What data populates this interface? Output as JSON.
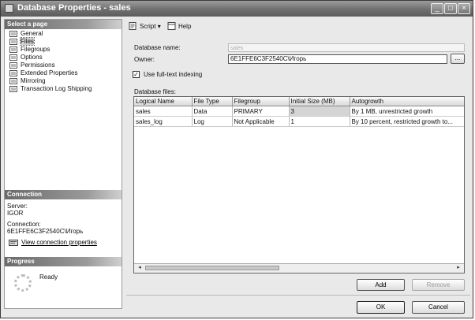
{
  "window": {
    "title": "Database Properties - sales",
    "minimize": "_",
    "maximize": "□",
    "close": "×"
  },
  "sidebar": {
    "header": "Select a page",
    "items": [
      {
        "label": "General"
      },
      {
        "label": "Files"
      },
      {
        "label": "Filegroups"
      },
      {
        "label": "Options"
      },
      {
        "label": "Permissions"
      },
      {
        "label": "Extended Properties"
      },
      {
        "label": "Mirroring"
      },
      {
        "label": "Transaction Log Shipping"
      }
    ],
    "selected_index": 1
  },
  "connection": {
    "header": "Connection",
    "server_label": "Server:",
    "server_value": "IGOR",
    "connection_label": "Connection:",
    "connection_value": "6E1FFE6C3F2540C\\Игорь",
    "view_link": "View connection properties"
  },
  "progress": {
    "header": "Progress",
    "status": "Ready"
  },
  "toolbar": {
    "script_label": "Script",
    "script_dropdown": "▾",
    "help_label": "Help"
  },
  "form": {
    "dbname_label": "Database name:",
    "dbname_value": "sales",
    "owner_label": "Owner:",
    "owner_value": "6E1FFE6C3F2540C\\Игорь",
    "browse_button": "...",
    "fulltext_label": "Use full-text indexing",
    "fulltext_checked": true,
    "fulltext_mark": "✓",
    "files_label": "Database files:"
  },
  "files_table": {
    "columns": [
      "Logical Name",
      "File Type",
      "Filegroup",
      "Initial Size (MB)",
      "Autogrowth"
    ],
    "rows": [
      [
        "sales",
        "Data",
        "PRIMARY",
        "3",
        "By 1 MB, unrestricted growth"
      ],
      [
        "sales_log",
        "Log",
        "Not Applicable",
        "1",
        "By 10 percent, restricted growth to..."
      ]
    ]
  },
  "scrollbar": {
    "left_arrow": "◂",
    "right_arrow": "▸"
  },
  "buttons": {
    "add": "Add",
    "remove": "Remove",
    "ok": "OK",
    "cancel": "Cancel"
  },
  "colors": {
    "title_bar": "#6f6f6f",
    "pane_header": "#6a6a6a",
    "selected_cell": "#d5d5d5"
  }
}
